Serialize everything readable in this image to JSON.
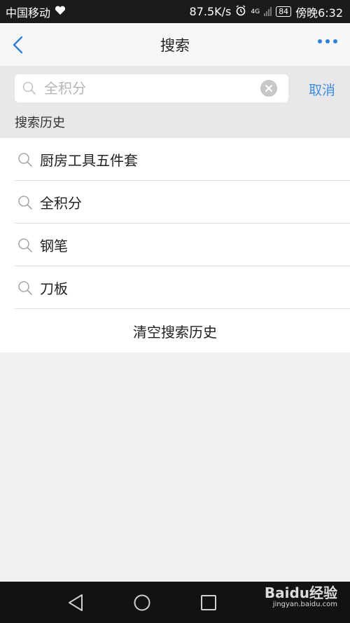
{
  "status_bar": {
    "carrier": "中国移动",
    "speed": "87.5K/s",
    "network": "4G",
    "battery": "84",
    "time": "傍晚6:32"
  },
  "header": {
    "title": "搜索"
  },
  "search": {
    "value": "",
    "placeholder": "全积分",
    "cancel_label": "取消"
  },
  "history": {
    "title": "搜索历史",
    "items": [
      {
        "label": "厨房工具五件套"
      },
      {
        "label": "全积分"
      },
      {
        "label": "钢笔"
      },
      {
        "label": "刀板"
      }
    ],
    "clear_label": "清空搜索历史"
  },
  "watermark": {
    "brand": "Baidu经验",
    "url": "jingyan.baidu.com"
  },
  "colors": {
    "accent": "#2f7fde",
    "cancel": "#3f8fe0",
    "background": "#f0f0f2"
  }
}
